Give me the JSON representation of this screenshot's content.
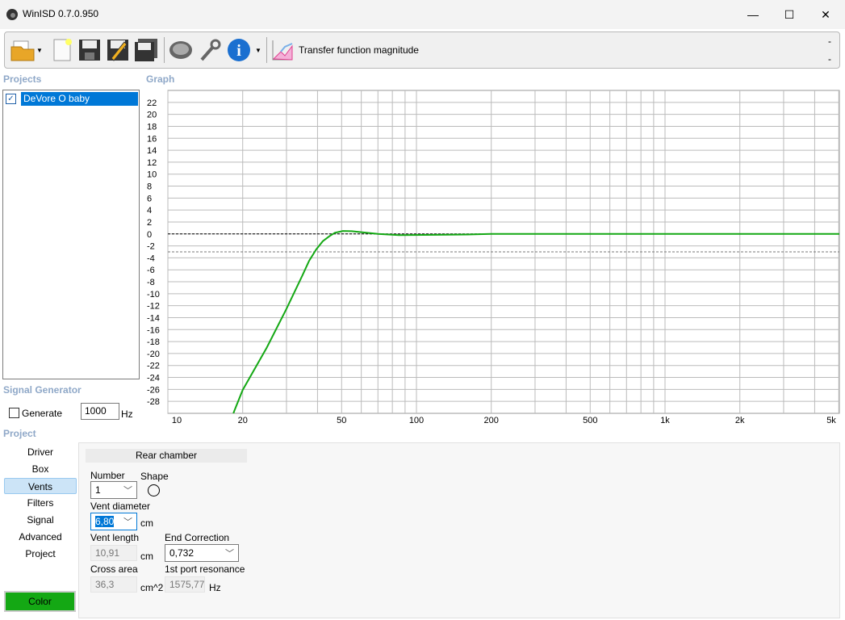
{
  "window": {
    "title": "WinISD 0.7.0.950",
    "minimize": "—",
    "maximize": "☐",
    "close": "✕"
  },
  "toolbar": {
    "items": [
      "open-folder-icon",
      "new-project-icon",
      "save-icon",
      "save-as-icon",
      "save-all-icon",
      "driver-icon",
      "settings-wrench-icon",
      "info-icon"
    ],
    "graph_selector_label": "Transfer function magnitude",
    "right_marks": [
      "-",
      "-"
    ]
  },
  "projects": {
    "heading": "Projects",
    "items": [
      {
        "name": "DeVore O baby",
        "checked": true
      }
    ]
  },
  "graph": {
    "heading": "Graph"
  },
  "signal_generator": {
    "heading": "Signal Generator",
    "generate_label": "Generate",
    "generate_checked": false,
    "frequency": "1000",
    "unit": "Hz"
  },
  "project_nav": {
    "heading": "Project",
    "items": [
      "Driver",
      "Box",
      "Vents",
      "Filters",
      "Signal",
      "Advanced",
      "Project"
    ],
    "selected": "Vents",
    "color_button": "Color",
    "color": "#14a814"
  },
  "vents": {
    "section": "Rear chamber",
    "number_label": "Number",
    "number_value": "1",
    "shape_label": "Shape",
    "diameter_label": "Vent diameter",
    "diameter_value": "6,80",
    "diameter_unit": "cm",
    "length_label": "Vent length",
    "length_value": "10,91",
    "length_unit": "cm",
    "end_correction_label": "End Correction",
    "end_correction_value": "0,732",
    "cross_area_label": "Cross area",
    "cross_area_value": "36,3",
    "cross_area_unit": "cm^2",
    "resonance_label": "1st port resonance",
    "resonance_value": "1575,77",
    "resonance_unit": "Hz"
  },
  "chart_data": {
    "type": "line",
    "title": "Transfer function magnitude",
    "xscale": "log",
    "xlim": [
      10,
      5100
    ],
    "ylim": [
      -30,
      24
    ],
    "x_ticks": [
      {
        "v": 10,
        "l": "10"
      },
      {
        "v": 20,
        "l": "20"
      },
      {
        "v": 50,
        "l": "50"
      },
      {
        "v": 100,
        "l": "100"
      },
      {
        "v": 200,
        "l": "200"
      },
      {
        "v": 500,
        "l": "500"
      },
      {
        "v": 1000,
        "l": "1k"
      },
      {
        "v": 2000,
        "l": "2k"
      },
      {
        "v": 5000,
        "l": "5k"
      }
    ],
    "y_ticks": [
      22,
      20,
      18,
      16,
      14,
      12,
      10,
      8,
      6,
      4,
      2,
      0,
      -2,
      -4,
      -6,
      -8,
      -10,
      -12,
      -14,
      -16,
      -18,
      -20,
      -22,
      -24,
      -26,
      -28
    ],
    "reference_lines": [
      0,
      -3
    ],
    "series": [
      {
        "name": "DeVore O baby",
        "color": "#14a814",
        "points": [
          [
            18,
            -31
          ],
          [
            18.5,
            -29.6
          ],
          [
            20,
            -26.1
          ],
          [
            25,
            -19
          ],
          [
            30,
            -12.5
          ],
          [
            34.8,
            -6.9
          ],
          [
            37,
            -4.5
          ],
          [
            39.5,
            -2.6
          ],
          [
            42,
            -1.2
          ],
          [
            44.6,
            -0.4
          ],
          [
            47,
            0.2
          ],
          [
            50.6,
            0.5
          ],
          [
            55,
            0.45
          ],
          [
            60,
            0.3
          ],
          [
            70,
            0
          ],
          [
            85,
            -0.2
          ],
          [
            120,
            -0.15
          ],
          [
            160,
            -0.1
          ],
          [
            200,
            0
          ],
          [
            500,
            0
          ],
          [
            1000,
            0
          ],
          [
            5100,
            0
          ]
        ]
      }
    ]
  }
}
